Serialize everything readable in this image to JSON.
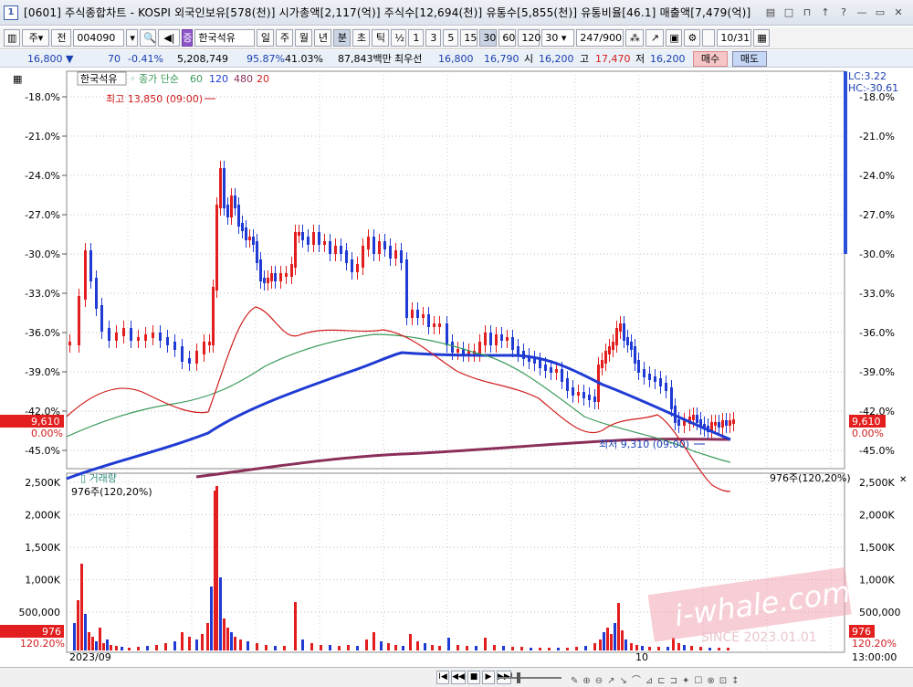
{
  "window": {
    "num": "1",
    "title": "[0601] 주식종합차트 - KOSPI 외국인보유[578(천)] 시가총액[2,117(억)] 주식수[12,694(천)] 유통수[5,855(천)] 유통비율[46.1] 매출액[7,479(억)]",
    "buttons": [
      "▤",
      "□",
      "⊓",
      "↑",
      "?",
      "—",
      "▭",
      "✕"
    ]
  },
  "toolbar": {
    "market": "주",
    "all": "전",
    "code": "004090",
    "name": "한국석유",
    "periods": [
      "일",
      "주",
      "월",
      "년",
      "분",
      "초",
      "틱"
    ],
    "selected_period": "분",
    "frac": "½",
    "intervals": [
      "1",
      "3",
      "5",
      "15",
      "30",
      "60",
      "120"
    ],
    "selected_interval": "30",
    "interval_value": "30",
    "count": "247",
    "count_max": "/900",
    "date": "10/31"
  },
  "info": {
    "price": "16,800",
    "change": "70",
    "change_pct": "-0.41%",
    "volume": "5,208,749",
    "ratio1": "95.87%",
    "ratio2": "41.03%",
    "amount": "87,843백만",
    "best_label": "최우선",
    "best_ask": "16,800",
    "best_bid": "16,790",
    "open_label": "시",
    "open": "16,200",
    "high_label": "고",
    "high": "17,470",
    "low_label": "저",
    "low": "16,200",
    "buy": "매수",
    "sell": "매도"
  },
  "price_chart": {
    "name_tag": "한국석유",
    "legend_prefix": "종가 단순",
    "ma_labels": [
      "60",
      "120",
      "480",
      "20"
    ],
    "ma_colors": [
      "#2e8b57",
      "#1a2fd0",
      "#e02020",
      "#c03030"
    ],
    "y_ticks": [
      "-18.0%",
      "-21.0%",
      "-24.0%",
      "-27.0%",
      "-30.0%",
      "-33.0%",
      "-36.0%",
      "-39.0%",
      "-42.0%",
      "-45.0%"
    ],
    "right_y_ticks": [
      "-18.0%",
      "-21.0%",
      "-24.0%",
      "-27.0%",
      "-30.0%",
      "-33.0%",
      "-36.0%",
      "-39.0%",
      "-42.0%",
      "-45.0%"
    ],
    "current_price_tag": "9,610",
    "current_pct_tag": "0.00%",
    "lc": "LC:3.22",
    "hc": "HC:-30.61",
    "high_note": "최고 13,850 (09:00)",
    "low_note": "최저 9,310 (09:00)"
  },
  "volume_chart": {
    "title": "거래량",
    "value": "976주(120,20%)",
    "right_value": "976주(120,20%)",
    "y_ticks": [
      "2,500K",
      "2,000K",
      "1,500K",
      "1,000K",
      "500,000"
    ],
    "right_y_ticks": [
      "2,500K",
      "2,000K",
      "1,500K",
      "1,000K",
      "500,000"
    ],
    "current_tag": "976",
    "pct_tag": "120.20%"
  },
  "x_axis": {
    "label_start": "2023/09",
    "label_mid": "10",
    "label_right": "13:00:00"
  },
  "watermark": {
    "text": "i-whale.com",
    "since": "SINCE 2023.01.01"
  },
  "bottom": {
    "controls": [
      "I◀",
      "◀◀",
      "■",
      "▶",
      "▶▶I"
    ]
  }
}
